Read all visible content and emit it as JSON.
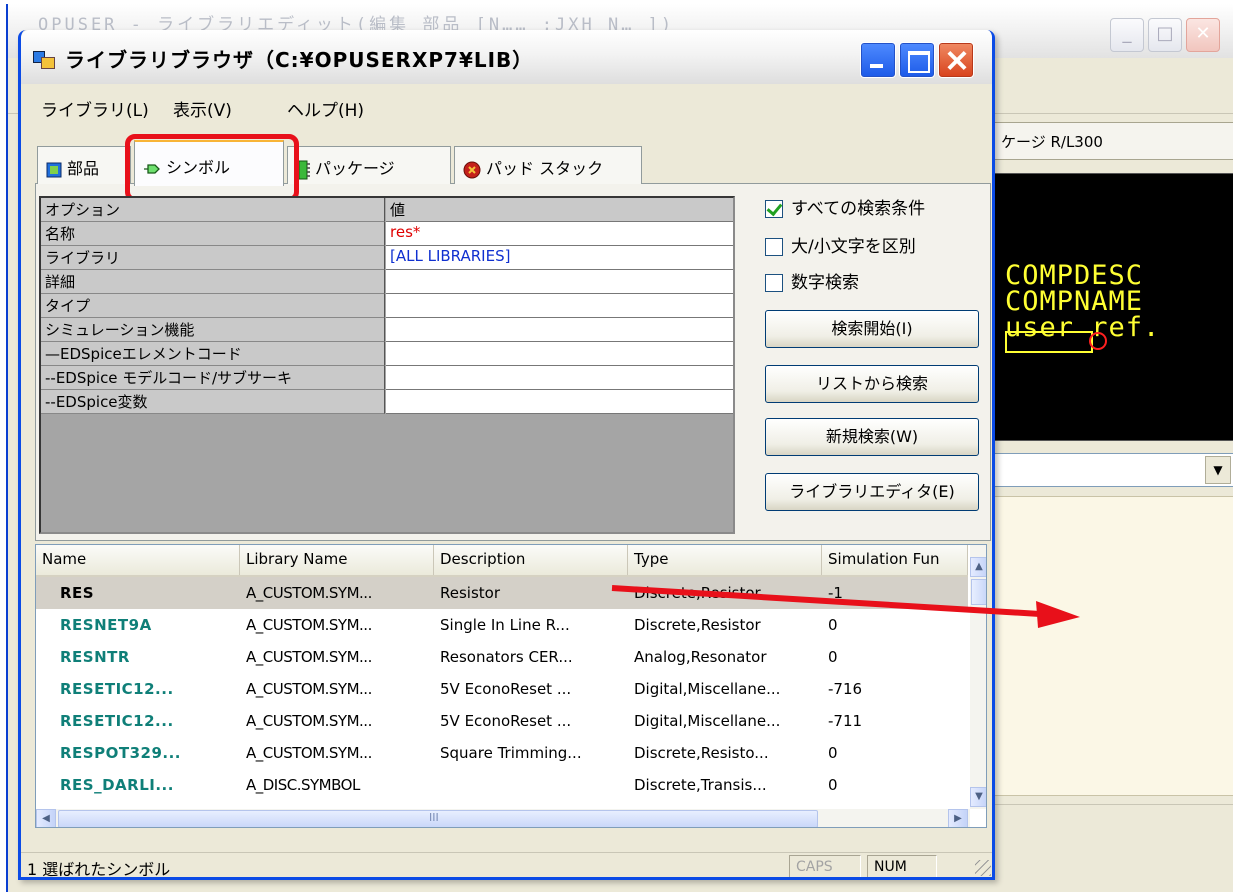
{
  "bg_window": {
    "title": "OPUSER - ライブラリエディット(編集 部品 [N…… ;JXH N… ])",
    "field_text": "ケージ R/L300",
    "preview_lines": [
      "COMPDESC",
      "COMPNAME",
      "user ref."
    ]
  },
  "dialog": {
    "title": "ライブラリブラウザ（C:¥OPUSERXP7¥LIB）"
  },
  "menu": {
    "items": [
      "ライブラリ(L)",
      "表示(V)",
      "ヘルプ(H)"
    ]
  },
  "tabs": [
    {
      "label": "部品",
      "icon": "component-icon"
    },
    {
      "label": "シンボル",
      "icon": "symbol-icon",
      "active": true
    },
    {
      "label": "パッケージ",
      "icon": "package-icon"
    },
    {
      "label": "パッド スタック",
      "icon": "padstack-icon"
    }
  ],
  "property_grid": {
    "header": {
      "name": "オプション",
      "value": "値"
    },
    "rows": [
      {
        "name": "名称",
        "value": "res*"
      },
      {
        "name": "ライブラリ",
        "value": "[ALL LIBRARIES]"
      },
      {
        "name": "詳細",
        "value": ""
      },
      {
        "name": "タイプ",
        "value": ""
      },
      {
        "name": "シミュレーション機能",
        "value": ""
      },
      {
        "name": "—EDSpiceエレメントコード",
        "value": ""
      },
      {
        "name": "--EDSpice モデルコード/サブサーキ",
        "value": ""
      },
      {
        "name": "--EDSpice変数",
        "value": ""
      }
    ]
  },
  "options": {
    "all_criteria": {
      "label": "すべての検索条件",
      "checked": true
    },
    "case_sensitive": {
      "label": "大/小文字を区別",
      "checked": false
    },
    "numeric_search": {
      "label": "数字検索",
      "checked": false
    }
  },
  "buttons": {
    "start_search": "検索開始(I)",
    "search_from_list": "リストから検索",
    "new_search": "新規検索(W)",
    "library_editor": "ライブラリエディタ(E)"
  },
  "list": {
    "columns": [
      "Name",
      "Library Name",
      "Description",
      "Type",
      "Simulation Fun"
    ],
    "rows": [
      {
        "name": "RES",
        "library": "A_CUSTOM.SYM...",
        "description": "Resistor",
        "type": "Discrete,Resistor",
        "sim": "-1",
        "selected": true
      },
      {
        "name": "RESNET9A",
        "library": "A_CUSTOM.SYM...",
        "description": "Single In Line R...",
        "type": "Discrete,Resistor",
        "sim": "0"
      },
      {
        "name": "RESNTR",
        "library": "A_CUSTOM.SYM...",
        "description": "Resonators CER...",
        "type": "Analog,Resonator",
        "sim": "0"
      },
      {
        "name": "RESETIC12...",
        "library": "A_CUSTOM.SYM...",
        "description": "5V EconoReset ...",
        "type": "Digital,Miscellane...",
        "sim": "-716"
      },
      {
        "name": "RESETIC12...",
        "library": "A_CUSTOM.SYM...",
        "description": "5V EconoReset ...",
        "type": "Digital,Miscellane...",
        "sim": "-711"
      },
      {
        "name": "RESPOT329...",
        "library": "A_CUSTOM.SYM...",
        "description": "Square Trimming...",
        "type": "Discrete,Resisto...",
        "sim": "0"
      },
      {
        "name": "RES_DARLI...",
        "library": "A_DISC.SYMBOL",
        "description": "",
        "type": "Discrete,Transis...",
        "sim": "0"
      }
    ],
    "scroll_mark": "III"
  },
  "status": {
    "text": "1 選ばれたシンボル",
    "caps": "CAPS",
    "num": "NUM"
  },
  "colors": {
    "highlight": "#e8101a",
    "arrow": "#e8101a",
    "name_column": "#0f7f78",
    "preview_text": "#ffff33"
  }
}
